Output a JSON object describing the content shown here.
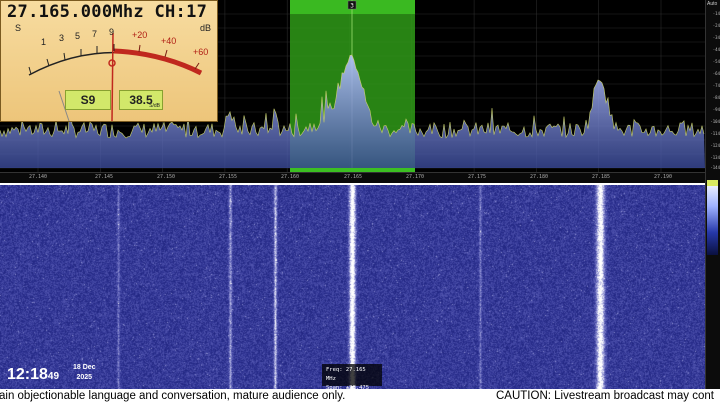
{
  "meter": {
    "frequency_label": "27.165.000Mhz CH:17",
    "s_unit": "S",
    "db_unit": "dB",
    "scale_s": [
      "1",
      "3",
      "5",
      "7",
      "9"
    ],
    "scale_db": [
      "+20",
      "+40",
      "+60"
    ],
    "s_reading": "S9",
    "db_reading": "38.5",
    "db_reading_unit": "S/dB"
  },
  "spectrum": {
    "freq_ticks": [
      "27.140",
      "27.145",
      "27.150",
      "27.155",
      "27.160",
      "27.165",
      "27.170",
      "27.175",
      "27.180",
      "27.185",
      "27.190"
    ],
    "marker_label": "3",
    "highlight_color": "#2f9a18",
    "trace_color": "#8aa0e0"
  },
  "right_panel": {
    "auto_label": "Auto",
    "levels": [
      "-14",
      "-24",
      "-34",
      "-44",
      "-54",
      "-64",
      "-74",
      "-84",
      "-94",
      "-104",
      "-114",
      "-124",
      "-134",
      "-144"
    ]
  },
  "overlay": {
    "time": "12:18",
    "seconds": "49",
    "date_line1": "18 Dec",
    "date_line2": "2025",
    "freq_line": "Freq:  27.165 MHz",
    "span_line": "Span: ±28.475 kHz"
  },
  "ticker": {
    "text_left": "ain objectionable language and conversation, mature audience only.",
    "text_right": "CAUTION:  Livestream broadcast may cont"
  }
}
